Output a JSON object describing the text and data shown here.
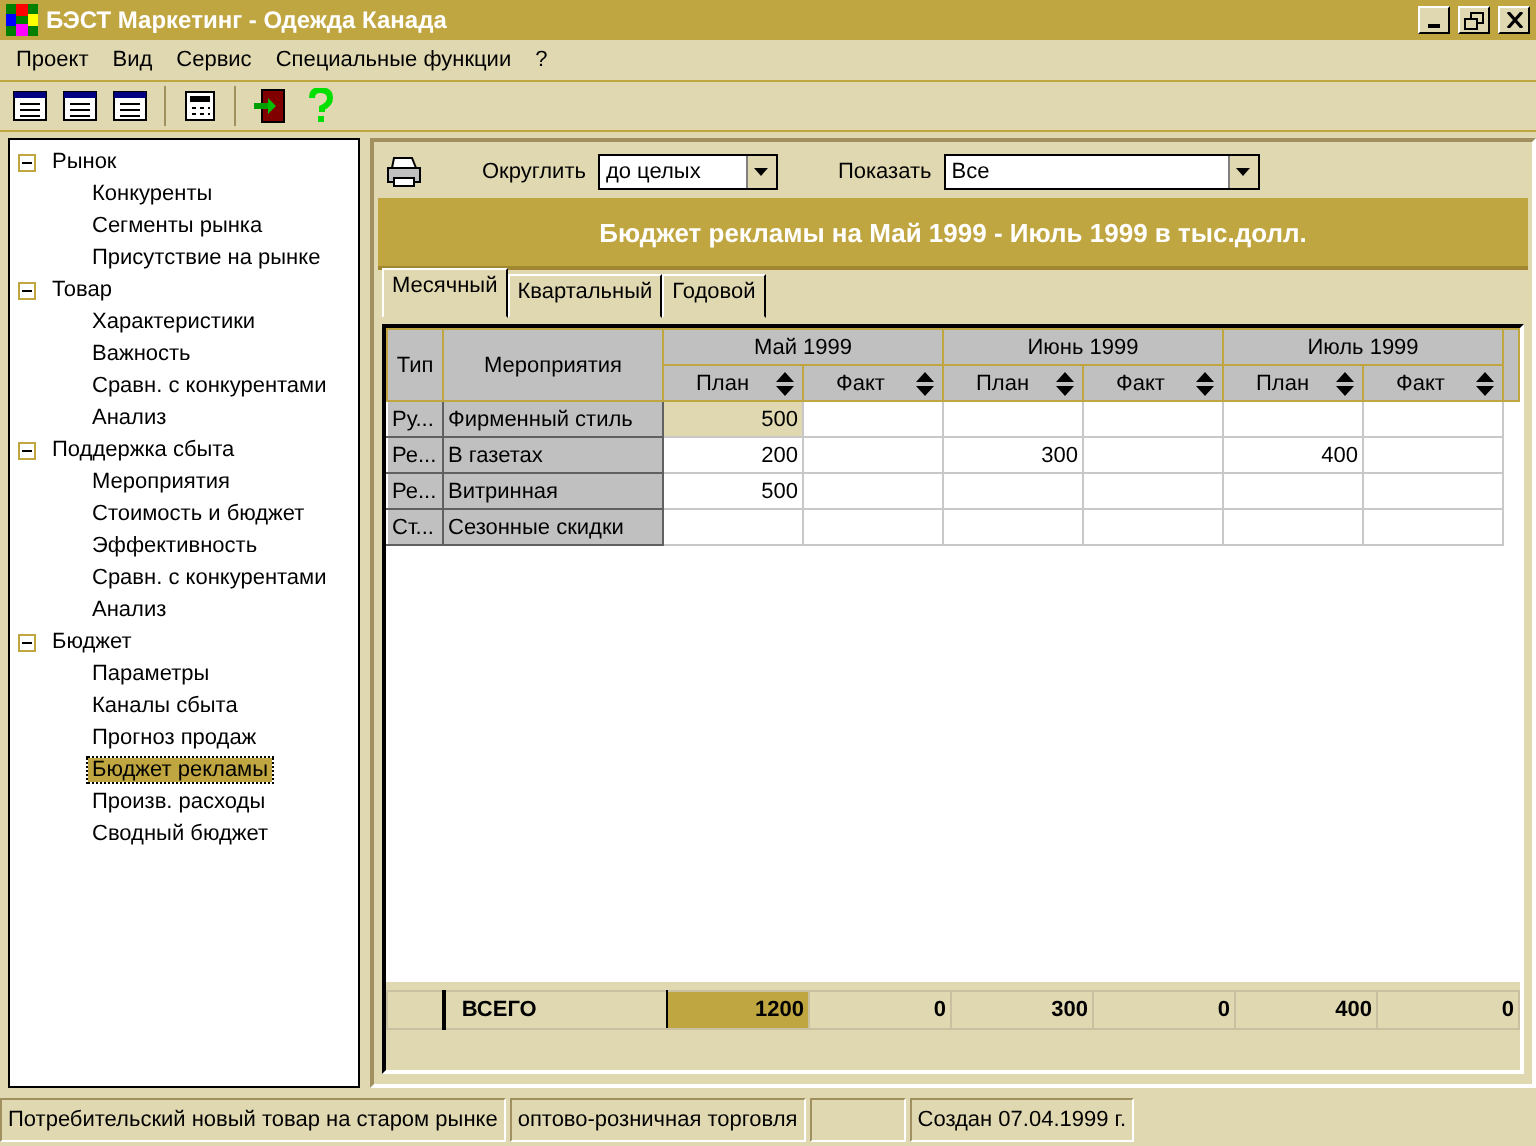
{
  "window": {
    "title": "БЭСТ Маркетинг - Одежда Канада"
  },
  "menu": [
    "Проект",
    "Вид",
    "Сервис",
    "Специальные функции",
    "?"
  ],
  "tree": [
    {
      "label": "Рынок",
      "expanded": true,
      "children": [
        {
          "label": "Конкуренты",
          "selected": false
        },
        {
          "label": "Сегменты рынка",
          "selected": false
        },
        {
          "label": "Присутствие на рынке",
          "selected": false
        }
      ]
    },
    {
      "label": "Товар",
      "expanded": true,
      "children": [
        {
          "label": "Характеристики",
          "selected": false
        },
        {
          "label": "Важность",
          "selected": false
        },
        {
          "label": "Сравн. с конкурентами",
          "selected": false
        },
        {
          "label": "Анализ",
          "selected": false
        }
      ]
    },
    {
      "label": "Поддержка сбыта",
      "expanded": true,
      "children": [
        {
          "label": "Мероприятия",
          "selected": false
        },
        {
          "label": "Стоимость и бюджет",
          "selected": false
        },
        {
          "label": "Эффективность",
          "selected": false
        },
        {
          "label": "Сравн. с конкурентами",
          "selected": false
        },
        {
          "label": "Анализ",
          "selected": false
        }
      ]
    },
    {
      "label": "Бюджет",
      "expanded": true,
      "children": [
        {
          "label": "Параметры",
          "selected": false
        },
        {
          "label": "Каналы сбыта",
          "selected": false
        },
        {
          "label": "Прогноз продаж",
          "selected": false
        },
        {
          "label": "Бюджет рекламы",
          "selected": true
        },
        {
          "label": "Произв. расходы",
          "selected": false
        },
        {
          "label": "Сводный бюджет",
          "selected": false
        }
      ]
    }
  ],
  "filters": [
    {
      "label": "Округлить",
      "value": "до целых"
    },
    {
      "label": "Показать",
      "value": "Все"
    }
  ],
  "report_title": "Бюджет рекламы на Май 1999 - Июль 1999 в тыс.долл.",
  "tabs": [
    {
      "label": "Месячный",
      "selected": true
    },
    {
      "label": "Квартальный",
      "selected": false
    },
    {
      "label": "Годовой",
      "selected": false
    }
  ],
  "table": {
    "columns": [
      "Тип",
      "Мероприятия"
    ],
    "months": [
      {
        "label": "Май 1999",
        "columns": [
          "План",
          "Факт"
        ]
      },
      {
        "label": "Июнь 1999",
        "columns": [
          "План",
          "Факт"
        ]
      },
      {
        "label": "Июль 1999",
        "columns": [
          "План",
          "Факт"
        ]
      }
    ],
    "rows": [
      {
        "type": "Ру...",
        "name": "Фирменный стиль",
        "cells": [
          {
            "text": "500",
            "selected": true
          },
          {
            "selected": false
          },
          {
            "selected": false
          },
          {
            "selected": false
          },
          {
            "selected": false
          },
          {
            "selected": false
          }
        ]
      },
      {
        "type": "Ре...",
        "name": "В газетах",
        "cells": [
          {
            "text": "200",
            "selected": false
          },
          {
            "selected": false
          },
          {
            "text": "300",
            "selected": false
          },
          {
            "selected": false
          },
          {
            "text": "400",
            "selected": false
          },
          {
            "selected": false
          }
        ]
      },
      {
        "type": "Ре...",
        "name": "Витринная",
        "cells": [
          {
            "text": "500",
            "selected": false
          },
          {
            "selected": false
          },
          {
            "selected": false
          },
          {
            "selected": false
          },
          {
            "selected": false
          },
          {
            "selected": false
          }
        ]
      },
      {
        "type": "Ст...",
        "name": "Сезонные скидки",
        "cells": [
          {
            "selected": false
          },
          {
            "selected": false
          },
          {
            "selected": false
          },
          {
            "selected": false
          },
          {
            "selected": false
          },
          {
            "selected": false
          }
        ]
      }
    ],
    "total": {
      "label": "ВСЕГО",
      "cells": [
        {
          "text": "1200",
          "selected": true
        },
        {
          "text": "0",
          "selected": false
        },
        {
          "text": "300",
          "selected": false
        },
        {
          "text": "0",
          "selected": false
        },
        {
          "text": "400",
          "selected": false
        },
        {
          "text": "0",
          "selected": false
        }
      ]
    }
  },
  "status_bar": [
    {
      "kind": "text",
      "text": "Потребительский новый товар на старом рынке"
    },
    {
      "kind": "text",
      "text": "оптово-розничная торговля"
    },
    {
      "kind": "blank"
    },
    {
      "kind": "text",
      "text": "Создан 07.04.1999 г."
    }
  ]
}
